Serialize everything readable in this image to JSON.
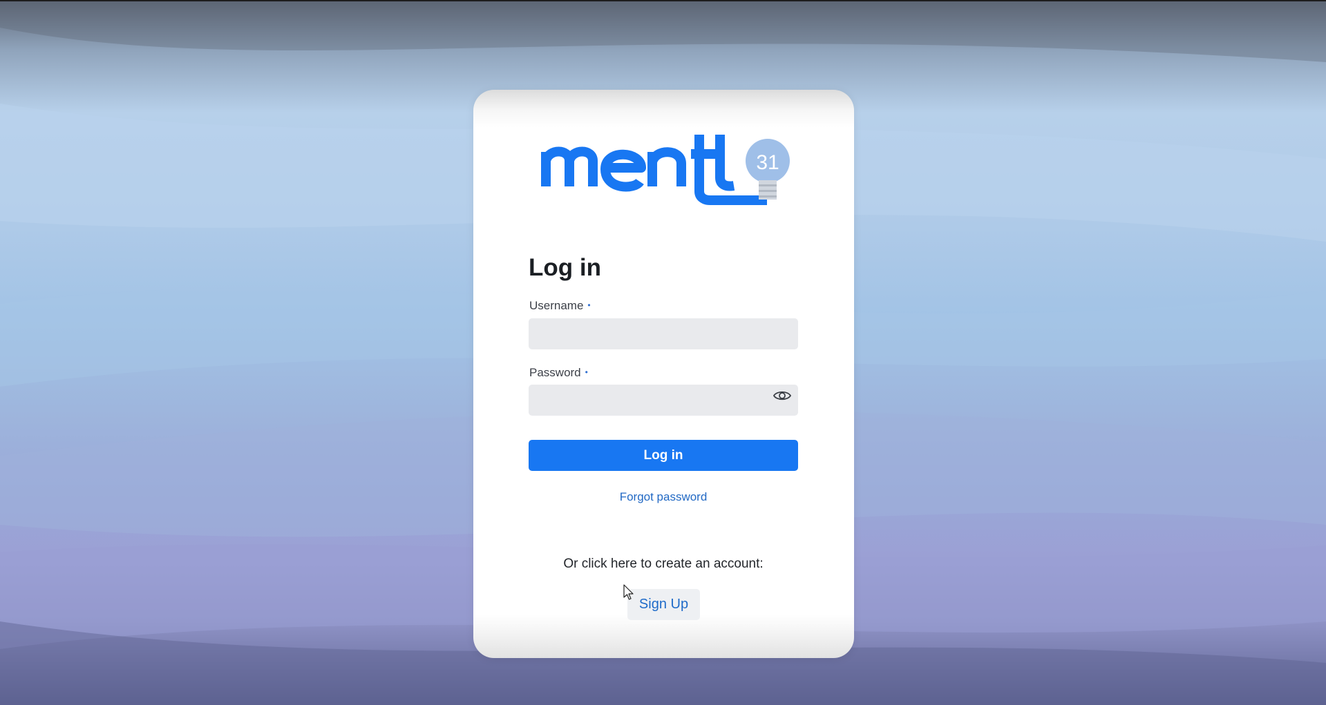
{
  "logo": {
    "text": "ment",
    "badge": "31",
    "brand_color": "#1877f2",
    "bulb_color": "#9fbfe8"
  },
  "login": {
    "title": "Log in",
    "username_label": "Username",
    "password_label": "Password",
    "required_marker": "•",
    "username_value": "",
    "password_value": "",
    "submit_label": "Log in",
    "forgot_label": "Forgot password"
  },
  "signup": {
    "prompt": "Or click here to create an account:",
    "button_label": "Sign Up"
  },
  "icons": {
    "password_toggle": "eye-icon",
    "cursor": "mouse-pointer"
  },
  "colors": {
    "primary": "#1877f2",
    "link": "#2269c4",
    "input_bg": "#e9eaed"
  }
}
